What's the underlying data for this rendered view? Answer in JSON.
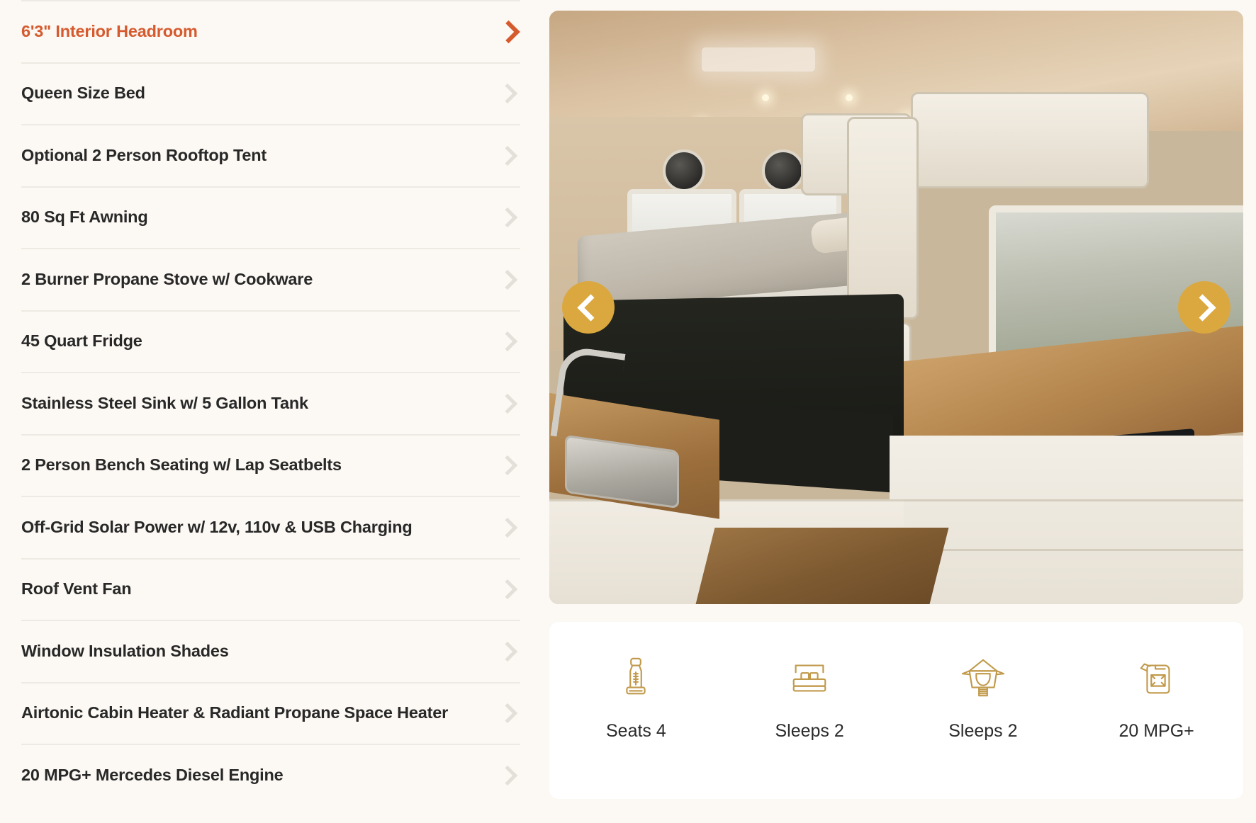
{
  "features": {
    "items": [
      {
        "label": "6'3\" Interior Headroom",
        "active": true
      },
      {
        "label": "Queen Size Bed",
        "active": false
      },
      {
        "label": "Optional 2 Person Rooftop Tent",
        "active": false
      },
      {
        "label": "80 Sq Ft Awning",
        "active": false
      },
      {
        "label": "2 Burner Propane Stove w/ Cookware",
        "active": false
      },
      {
        "label": "45 Quart Fridge",
        "active": false
      },
      {
        "label": "Stainless Steel Sink w/ 5 Gallon Tank",
        "active": false
      },
      {
        "label": "2 Person Bench Seating w/ Lap Seatbelts",
        "active": false
      },
      {
        "label": "Off-Grid Solar Power w/ 12v, 110v & USB Charging",
        "active": false
      },
      {
        "label": "Roof Vent Fan",
        "active": false
      },
      {
        "label": "Window Insulation Shades",
        "active": false
      },
      {
        "label": "Airtonic Cabin Heater & Radiant Propane Space Heater",
        "active": false
      },
      {
        "label": "20 MPG+ Mercedes Diesel Engine",
        "active": false
      }
    ],
    "active_color": "#D55A2E",
    "text_color": "#282828",
    "chevron_color": "#E3E0DA"
  },
  "gallery": {
    "alt": "Camper van interior with queen bed, bench seating, kitchen counter, sink and stove",
    "prev_icon": "chevron-left-icon",
    "next_icon": "chevron-right-icon",
    "button_color": "#DBA83F"
  },
  "specs": {
    "items": [
      {
        "icon": "seat-icon",
        "label": "Seats 4"
      },
      {
        "icon": "bed-icon",
        "label": "Sleeps 2"
      },
      {
        "icon": "rooftop-tent-icon",
        "label": "Sleeps 2"
      },
      {
        "icon": "fuel-can-icon",
        "label": "20 MPG+"
      }
    ],
    "icon_color": "#C19A4B"
  },
  "theme": {
    "page_background": "#FCF8F3",
    "card_background": "#FFFFFF",
    "divider": "#EDE9E3"
  }
}
